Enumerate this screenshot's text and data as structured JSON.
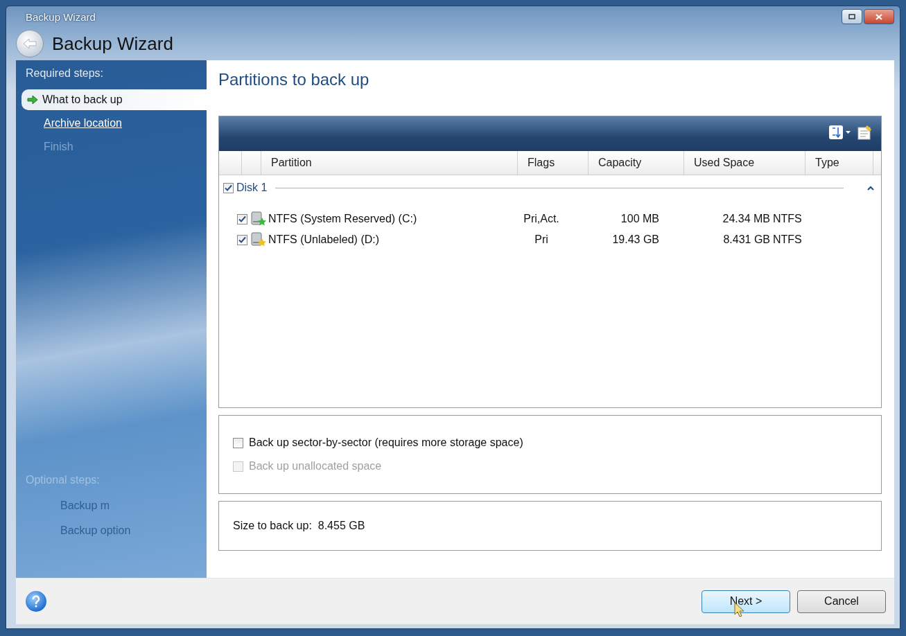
{
  "window": {
    "title": "Backup Wizard"
  },
  "header": {
    "title": "Backup Wizard"
  },
  "sidebar": {
    "required_heading": "Required steps:",
    "required_steps": [
      {
        "label": "What to back up",
        "kind": "current",
        "selected": true
      },
      {
        "label": "Archive location",
        "kind": "link",
        "selected": false
      },
      {
        "label": "Finish",
        "kind": "disabled",
        "selected": false
      }
    ],
    "optional_heading": "Optional steps:",
    "optional_steps": [
      {
        "label": "Backup m"
      },
      {
        "label": "Backup option"
      }
    ]
  },
  "page": {
    "title": "Partitions to back up"
  },
  "table": {
    "columns": [
      "Partition",
      "Flags",
      "Capacity",
      "Used Space",
      "Type"
    ],
    "groups": [
      {
        "label": "Disk 1",
        "checked": true,
        "expanded": true,
        "rows": [
          {
            "partition": "NTFS (System Reserved) (C:)",
            "checked": true,
            "color": "#3cb83c",
            "flags": "Pri,Act.",
            "capacity": "100 MB",
            "used_space": "24.34 MB",
            "type": "NTFS"
          },
          {
            "partition": "NTFS (Unlabeled) (D:)",
            "checked": true,
            "color": "#f0c020",
            "flags": "Pri",
            "capacity": "19.43 GB",
            "used_space": "8.431 GB",
            "type": "NTFS"
          }
        ]
      }
    ]
  },
  "options": [
    {
      "label": "Back up sector-by-sector (requires more storage space)",
      "checked": false,
      "disabled": false
    },
    {
      "label": "Back up unallocated space",
      "checked": false,
      "disabled": true
    }
  ],
  "size": {
    "label": "Size to back up:",
    "value": "8.455 GB"
  },
  "buttons": [
    {
      "label": "Next >",
      "kind": "primary"
    },
    {
      "label": "Cancel",
      "kind": "normal"
    }
  ]
}
